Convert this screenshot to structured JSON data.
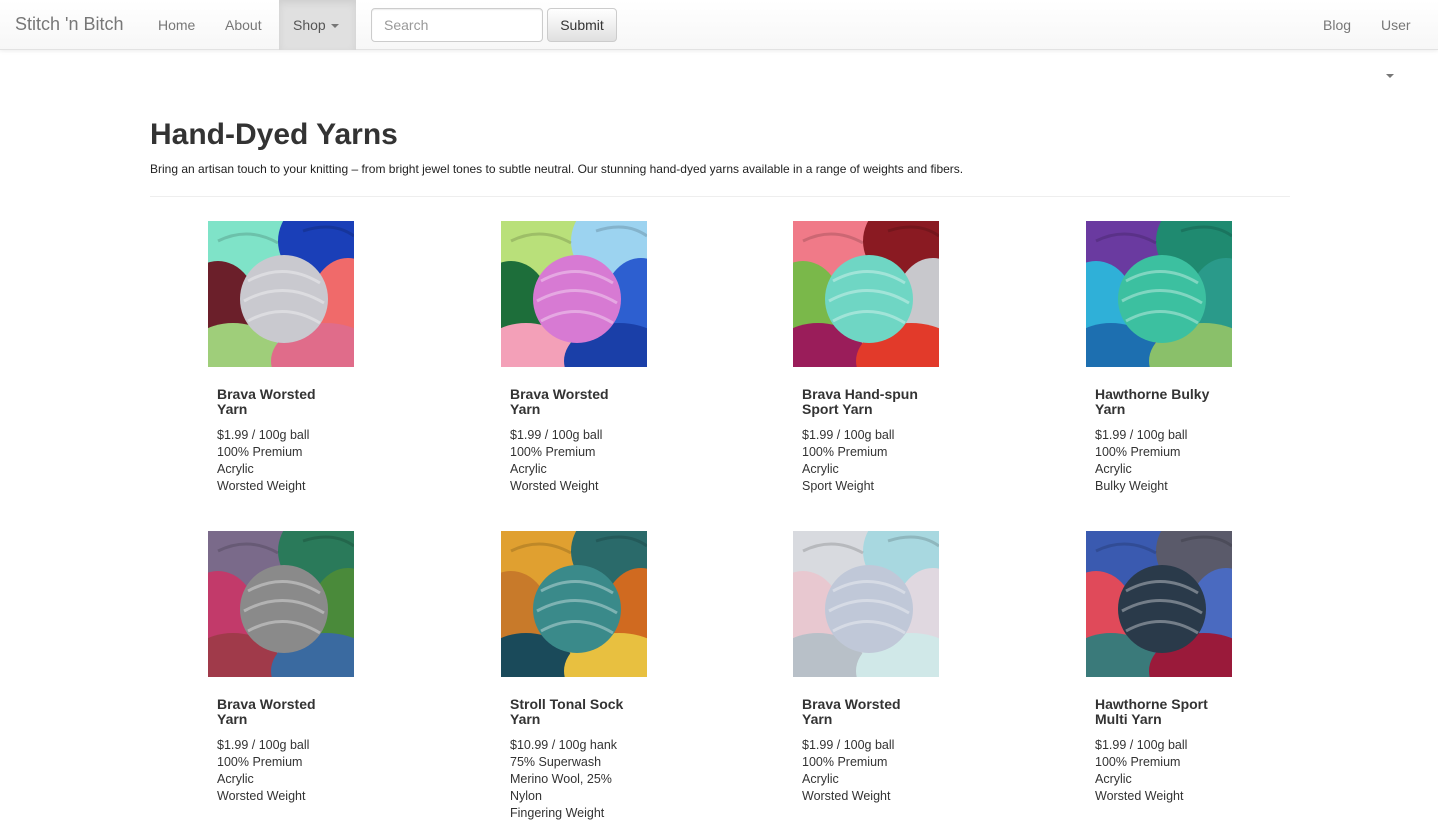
{
  "navbar": {
    "brand": "Stitch 'n Bitch",
    "home": "Home",
    "about": "About",
    "shop": "Shop",
    "search_placeholder": "Search",
    "submit": "Submit",
    "blog": "Blog",
    "user": "User"
  },
  "page": {
    "title": "Hand-Dyed Yarns",
    "lead": "Bring an artisan touch to your knitting – from bright jewel tones to subtle neutral. Our stunning hand-dyed yarns available in a range of weights and fibers."
  },
  "products": [
    {
      "name": "Brava Worsted Yarn",
      "price": "$1.99 / 100g ball",
      "fiber": "100% Premium Acrylic",
      "weight": "Worsted Weight",
      "colors": [
        "#7fe3c8",
        "#1a3fb8",
        "#6b1f2a",
        "#c9c9cf",
        "#e06c8a",
        "#9fce7a",
        "#f06a6a"
      ]
    },
    {
      "name": "Brava Worsted Yarn",
      "price": "$1.99 / 100g ball",
      "fiber": "100% Premium Acrylic",
      "weight": "Worsted Weight",
      "colors": [
        "#b9e07a",
        "#9cd3f0",
        "#1d6e3a",
        "#d77ad3",
        "#1a3fa8",
        "#f3a0b8",
        "#2d5fd0"
      ]
    },
    {
      "name": "Brava Hand-spun Sport Yarn",
      "price": "$1.99 / 100g ball",
      "fiber": "100% Premium Acrylic",
      "weight": "Sport Weight",
      "colors": [
        "#f07a88",
        "#8a1a22",
        "#7ab84a",
        "#6fd6c4",
        "#e23a2a",
        "#9a1d5a",
        "#c8c8cc"
      ]
    },
    {
      "name": "Hawthorne Bulky Yarn",
      "price": "$1.99 / 100g ball",
      "fiber": "100% Premium Acrylic",
      "weight": "Bulky Weight",
      "colors": [
        "#6a3aa0",
        "#1f8a70",
        "#2fb0d8",
        "#3cc0a0",
        "#8ac06a",
        "#1d6fb0",
        "#2a9a8a"
      ]
    },
    {
      "name": "Brava Worsted Yarn",
      "price": "$1.99 / 100g ball",
      "fiber": "100% Premium Acrylic",
      "weight": "Worsted Weight",
      "colors": [
        "#7a6a8a",
        "#2a7a5a",
        "#c23a6a",
        "#8a8a8a",
        "#3a6aa0",
        "#a03a4a",
        "#4a8a3a"
      ]
    },
    {
      "name": "Stroll Tonal Sock Yarn",
      "price": "$10.99 / 100g hank",
      "fiber": "75% Superwash Merino Wool, 25% Nylon",
      "weight": "Fingering Weight",
      "colors": [
        "#e0a030",
        "#2a6a6a",
        "#c87a2a",
        "#3a8a8a",
        "#e8c040",
        "#1a4a5a",
        "#d06a20"
      ]
    },
    {
      "name": "Brava Worsted Yarn",
      "price": "$1.99 / 100g ball",
      "fiber": "100% Premium Acrylic",
      "weight": "Worsted Weight",
      "colors": [
        "#d8dadf",
        "#a8d8e0",
        "#e8c8d0",
        "#c0c8d8",
        "#d0e8e8",
        "#b8c0c8",
        "#e0d8e0"
      ]
    },
    {
      "name": "Hawthorne Sport Multi Yarn",
      "price": "$1.99 / 100g ball",
      "fiber": "100% Premium Acrylic",
      "weight": "Worsted Weight",
      "colors": [
        "#3a5ab0",
        "#5a5a6a",
        "#e04a5a",
        "#2a3a4a",
        "#9a1a3a",
        "#3a7a7a",
        "#4a6ac0"
      ]
    }
  ]
}
